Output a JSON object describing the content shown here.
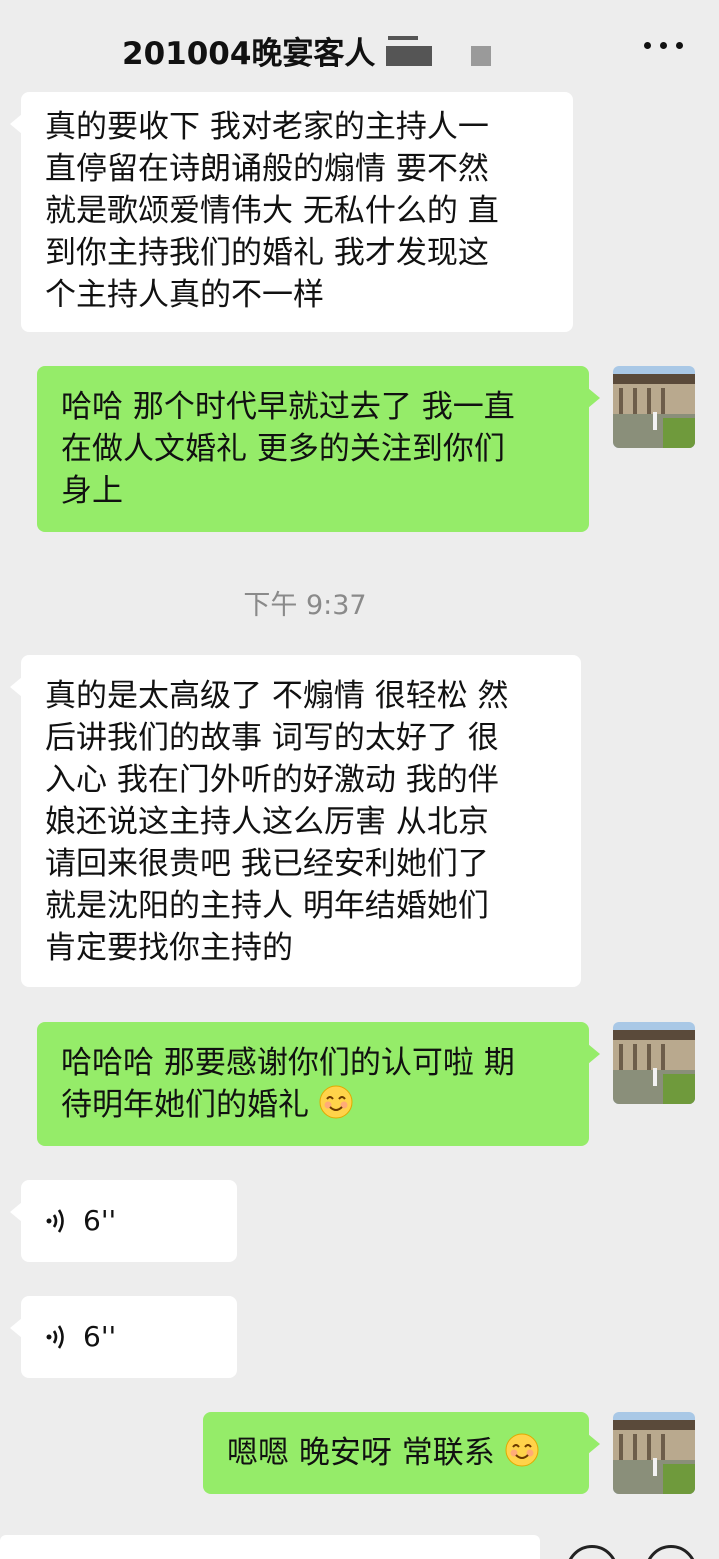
{
  "header": {
    "title": "201004晚宴客人"
  },
  "messages": [
    {
      "side": "left",
      "text": "真的要收下 我对老家的主持人一\n直停留在诗朗诵般的煽情 要不然\n就是歌颂爱情伟大 无私什么的 直\n到你主持我们的婚礼 我才发现这\n个主持人真的不一样"
    },
    {
      "side": "right",
      "text": "哈哈 那个时代早就过去了 我一直\n在做人文婚礼 更多的关注到你们\n身上"
    },
    {
      "side": "left",
      "text": "真的是太高级了 不煽情 很轻松 然\n后讲我们的故事 词写的太好了 很\n入心 我在门外听的好激动 我的伴\n娘还说这主持人这么厉害 从北京\n请回来很贵吧 我已经安利她们了\n就是沈阳的主持人 明年结婚她们\n肯定要找你主持的"
    },
    {
      "side": "right",
      "text_line1": "哈哈哈 那要感谢你们的认可啦 期",
      "text_line2": "待明年她们的婚礼 ",
      "emoji": "smiling-face"
    },
    {
      "side": "left",
      "type": "voice",
      "duration": "6''"
    },
    {
      "side": "left",
      "type": "voice",
      "duration": "6''"
    },
    {
      "side": "right",
      "text": "嗯嗯 晚安呀 常联系",
      "emoji": "smiling-face"
    }
  ],
  "timestamp": "下午 9:37",
  "colors": {
    "background": "#ededed",
    "incoming_bubble": "#ffffff",
    "outgoing_bubble": "#95ec69"
  }
}
